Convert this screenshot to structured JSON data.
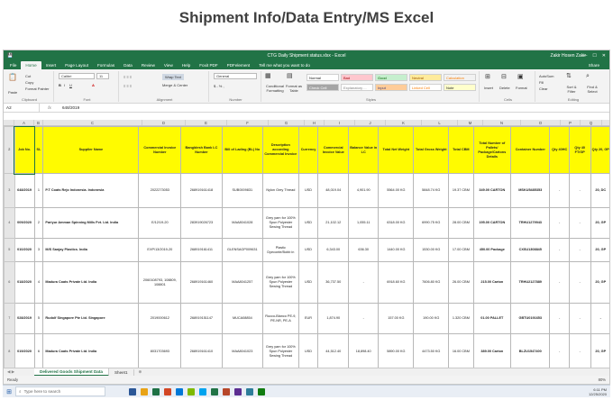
{
  "slide": {
    "title": "Shipment Info/Data Entry/MS Excel"
  },
  "window": {
    "title": "CTG Daily Shipment status.xlsx  -  Excel",
    "user": "Zakir Hosen Zakir",
    "controls": [
      "—",
      "☐",
      "✕"
    ]
  },
  "ribbon_tabs": [
    "File",
    "Home",
    "Insert",
    "Page Layout",
    "Formulas",
    "Data",
    "Review",
    "View",
    "Help",
    "Foxit PDF",
    "PDFelement",
    "Tell me what you want to do"
  ],
  "share_label": "Share",
  "ribbon": {
    "clipboard": {
      "paste": "Paste",
      "cut": "Cut",
      "copy": "Copy",
      "format_painter": "Format Painter",
      "label": "Clipboard"
    },
    "font": {
      "name": "Calibri",
      "size": "11",
      "label": "Font"
    },
    "alignment": {
      "wrap": "Wrap Text",
      "merge": "Merge & Center",
      "label": "Alignment"
    },
    "number": {
      "format": "General",
      "label": "Number"
    },
    "styles": {
      "conditional": "Conditional Formatting",
      "format_table": "Format as Table",
      "cells_label": "Styles",
      "items": [
        {
          "name": "Normal",
          "bg": "#ffffff",
          "fg": "#222222"
        },
        {
          "name": "Bad",
          "bg": "#ffc7ce",
          "fg": "#9c0006"
        },
        {
          "name": "Good",
          "bg": "#c6efce",
          "fg": "#006100"
        },
        {
          "name": "Neutral",
          "bg": "#ffeb9c",
          "fg": "#9c5700"
        },
        {
          "name": "Calculation",
          "bg": "#f2f2f2",
          "fg": "#fa7d00"
        },
        {
          "name": "Check Cell",
          "bg": "#a5a5a5",
          "fg": "#ffffff"
        },
        {
          "name": "Explanatory ...",
          "bg": "#ffffff",
          "fg": "#7f7f7f"
        },
        {
          "name": "Input",
          "bg": "#ffcc99",
          "fg": "#3f3f76"
        },
        {
          "name": "Linked Cell",
          "bg": "#ffffff",
          "fg": "#fa7d00"
        },
        {
          "name": "Note",
          "bg": "#ffffcc",
          "fg": "#222222"
        }
      ]
    },
    "cells": {
      "insert": "Insert",
      "delete": "Delete",
      "format": "Format",
      "label": "Cells"
    },
    "editing": {
      "autosum": "AutoSum",
      "fill": "Fill",
      "clear": "Clear",
      "sort": "Sort & Filter",
      "find": "Find & Select",
      "label": "Editing"
    }
  },
  "formula_bar": {
    "cell": "A2",
    "fx": "fx",
    "value": "648/2019"
  },
  "columns": [
    "A",
    "B",
    "C",
    "D",
    "E",
    "F",
    "G",
    "H",
    "I",
    "J",
    "K",
    "L",
    "M",
    "N",
    "O",
    "P",
    "Q",
    "R"
  ],
  "headers": [
    "Job No.",
    "SL",
    "Supplier Name",
    "Commercial Invoice Number",
    "Bangldesh Bank LC Number",
    "Bill of Lading (BL) No",
    "Description according Commercial Invoice",
    "Currency",
    "Commercial Invoice Value",
    "Balance Value in LC",
    "Total Net Weight",
    "Total Gross Weight",
    "Total CBM",
    "Total Number of Pallets/ Package/Cartons Details",
    "Container Number",
    "Qty 40HC",
    "Qty 40 FT/GP",
    "Qty 20, GP"
  ],
  "rows": [
    {
      "rn": "3",
      "cells": [
        "648/2019",
        "1",
        "P.T Coats Rejo Indonesia. Indonesia",
        "2022273053",
        "268919161418",
        "SUB0009831",
        "Nylon Grey Thread",
        "USD",
        "48,019.04",
        "4,901.90",
        "5564.00 KG",
        "5848.74 KG",
        "19.37 CBM",
        "349.00 CARTON",
        "MSKU5485353",
        "-",
        "-",
        "20, DC"
      ]
    },
    {
      "rn": "4",
      "cells": [
        "009/2020",
        "2",
        "Pariyur Amman Spinning Mills Pvt. Ltd. India",
        "E/12/19-20",
        "283919026723",
        "MAA8041028",
        "Grey yarn for 100% Spun Polyester Sewing Thread",
        "USD",
        "21,102.12",
        "1,055.11",
        "6318.00 KG",
        "6990.75 KG",
        "28.00 CBM",
        "195.00 CARTON",
        "TRHU1279943",
        "-",
        "-",
        "20, GP"
      ]
    },
    {
      "rn": "5",
      "cells": [
        "010/2020",
        "3",
        "M/S Sanjay Plastics. India",
        "EXP/13/2019-20",
        "268919161411",
        "GLENSAGP009631",
        "Plastic Dyeconte/Bobb in",
        "USD",
        "6,343.00",
        "636.30",
        "1440.00 KG",
        "1530.00 KG",
        "17.00 CBM",
        "450.00 Package",
        "CXSU1308845",
        "-",
        "-",
        "20, GP"
      ]
    },
    {
      "rn": "6",
      "cells": [
        "018/2020",
        "4",
        "Madura Coats Private Ltd. India",
        "2060108793, 108809, 108801",
        "268919161460",
        "MAA8041257",
        "Grey yarn for 100% Spun Polyester Sewing Thread",
        "USD",
        "36,737.50",
        "-",
        "6918.60 KG",
        "7606.80 KG",
        "26.00 CBM",
        "215.00 Carton",
        "TRHU2127889",
        "-",
        "-",
        "20, GP"
      ]
    },
    {
      "rn": "7",
      "cells": [
        "028/2019",
        "5",
        "Rudolf Singapore Pte Ltd. Singapore",
        "2019000612",
        "268919151147",
        "MUCA08854",
        "Rucco-Blanco PE-9, PE-NR, PE-A",
        "EUR",
        "1,874.90",
        "-",
        "157.00 KG",
        "190.00 KG",
        "1.320 CBM",
        "01.00 PALLET",
        "GBTU0191653",
        "-",
        "-",
        "-"
      ]
    },
    {
      "rn": "8",
      "cells": [
        "019/2020",
        "6",
        "Madura Coats Private Ltd. India",
        "8031703693",
        "268919161410",
        "MAA8041023",
        "Grey yarn for 100% Spun Polyester Sewing Thread",
        "USD",
        "44,512.40",
        "18,898.40",
        "5890.00 KG",
        "4473.50 KG",
        "16.00 CBM",
        "389.00 Carton",
        "BLZU1547400",
        "-",
        "-",
        "20, GP"
      ]
    }
  ],
  "sheet_tabs": [
    "Delivered Goods Shipment Data",
    "Sheet1"
  ],
  "status": {
    "ready": "Ready",
    "zoom": "80%"
  },
  "taskbar": {
    "search_placeholder": "Type here to search",
    "time": "6:11 PM",
    "date": "12/25/2020"
  }
}
